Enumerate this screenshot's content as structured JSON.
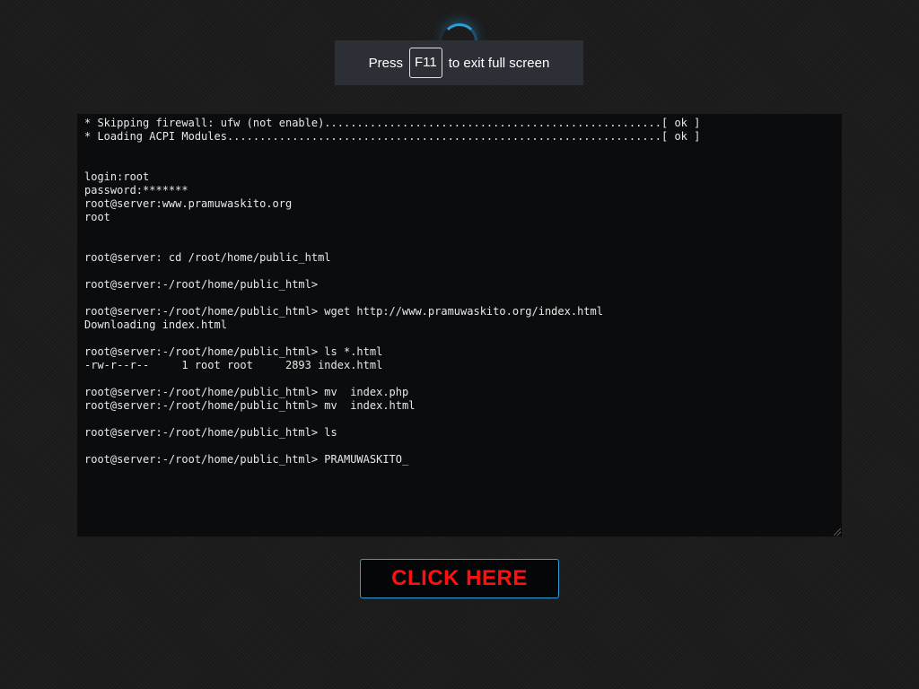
{
  "fullscreen_notice": {
    "prefix": "Press",
    "key": "F11",
    "suffix": "to exit full screen"
  },
  "terminal": {
    "lines": [
      "* Skipping firewall: ufw (not enable)....................................................[ ok ]",
      "* Loading ACPI Modules...................................................................[ ok ]",
      "",
      "",
      "login:root",
      "password:*******",
      "root@server:www.pramuwaskito.org",
      "root",
      "",
      "",
      "root@server: cd /root/home/public_html",
      "",
      "root@server:-/root/home/public_html>",
      "",
      "root@server:-/root/home/public_html> wget http://www.pramuwaskito.org/index.html",
      "Downloading index.html",
      "",
      "root@server:-/root/home/public_html> ls *.html",
      "-rw-r--r--     1 root root     2893 index.html",
      "",
      "root@server:-/root/home/public_html> mv  index.php",
      "root@server:-/root/home/public_html> mv  index.html",
      "",
      "root@server:-/root/home/public_html> ls",
      "",
      "root@server:-/root/home/public_html> PRAMUWASKITO_"
    ]
  },
  "cta_button": {
    "label": "CLICK HERE"
  },
  "colors": {
    "accent": "#2a9fd6",
    "cta_text": "#ff1010",
    "terminal_bg": "#0b0c0d"
  }
}
